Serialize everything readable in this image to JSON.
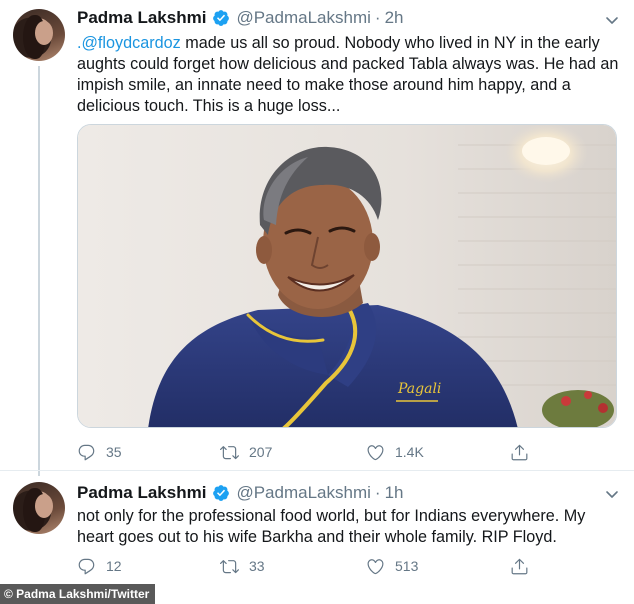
{
  "tweets": [
    {
      "author_name": "Padma Lakshmi",
      "handle": "@PadmaLakshmi",
      "separator": "·",
      "time": "2h",
      "text_mention": ".@floydcardoz",
      "text_body": " made us all so proud. Nobody who lived in NY in the early aughts could forget how delicious and packed Tabla always was. He had an impish smile, an innate need to make those around him happy, and a delicious touch. This is a huge loss...",
      "reply_count": "35",
      "retweet_count": "207",
      "like_count": "1.4K",
      "image_embroidery": "Pagali"
    },
    {
      "author_name": "Padma Lakshmi",
      "handle": "@PadmaLakshmi",
      "separator": "·",
      "time": "1h",
      "text_body": "not only for the professional food world, but for Indians everywhere. My heart goes out to his wife Barkha and their whole family. RIP Floyd.",
      "reply_count": "12",
      "retweet_count": "33",
      "like_count": "513"
    }
  ],
  "credit": "© Padma Lakshmi/Twitter",
  "colors": {
    "verified_blue": "#1da1f2",
    "mention_blue": "#1b95e0",
    "muted_gray": "#657786",
    "text_dark": "#14171a",
    "chef_jacket": "#2a3a78",
    "jacket_piping": "#e8c53a"
  },
  "icons": [
    "verified-badge-icon",
    "chevron-down-icon",
    "reply-icon",
    "retweet-icon",
    "like-icon",
    "share-icon"
  ]
}
